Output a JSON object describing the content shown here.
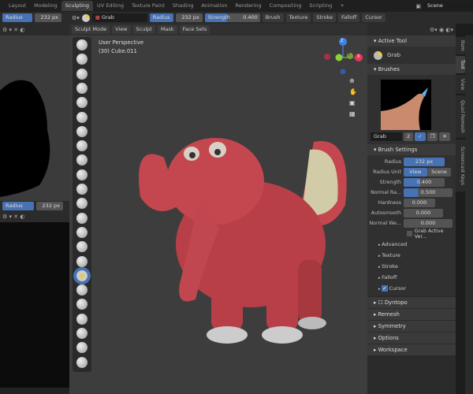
{
  "workspaces": [
    "Layout",
    "Modeling",
    "Sculpting",
    "UV Editing",
    "Texture Paint",
    "Shading",
    "Animation",
    "Rendering",
    "Compositing",
    "Scripting",
    "+"
  ],
  "active_workspace": "Sculpting",
  "scene": "Scene",
  "left_header": {
    "radius_label": "Radius",
    "radius_value": "232 px"
  },
  "tool_header": {
    "brush_name": "Grab",
    "radius_label": "Radius",
    "radius_value": "232 px",
    "strength_label": "Strength",
    "strength_value": "0.400",
    "strength_fraction": 0.4,
    "menus": [
      "Brush",
      "Texture",
      "Stroke",
      "Falloff",
      "Cursor"
    ]
  },
  "viewport_header": {
    "mode": "Sculpt Mode",
    "menus": [
      "View",
      "Sculpt",
      "Mask",
      "Face Sets"
    ]
  },
  "viewport": {
    "perspective": "User Perspective",
    "object": "(30) Cube.011",
    "gizmo": {
      "z": "Z",
      "y": "Y",
      "x": "X"
    }
  },
  "npanel": {
    "tabs": [
      "Item",
      "Tool",
      "View",
      "Quad Remesh",
      "Screencast Keys"
    ],
    "active_tab": "Tool",
    "active_tool": {
      "title": "Active Tool",
      "name": "Grab"
    },
    "brushes": {
      "title": "Brushes",
      "name": "Grab",
      "users": "2"
    },
    "brush_settings": {
      "title": "Brush Settings",
      "radius_label": "Radius",
      "radius_value": "232 px",
      "radius_unit_label": "Radius Unit",
      "radius_unit_options": [
        "View",
        "Scene"
      ],
      "radius_unit_selected": "View",
      "strength_label": "Strength",
      "strength_value": "0.400",
      "normal_radius_label": "Normal Ra...",
      "normal_radius_value": "0.500",
      "hardness_label": "Hardness",
      "hardness_value": "0.000",
      "autosmooth_label": "Autosmooth",
      "autosmooth_value": "0.000",
      "normal_weight_label": "Normal We...",
      "normal_weight_value": "0.000",
      "grab_active_label": "Grab Active Ver...",
      "subpanels": [
        "Advanced",
        "Texture",
        "Stroke",
        "Falloff"
      ],
      "cursor_label": "Cursor"
    },
    "panels": [
      "Remesh",
      "Symmetry",
      "Options",
      "Workspace"
    ],
    "dyntopo_label": "Dyntopo"
  },
  "colors": {
    "accent": "#4772b3",
    "body": "#c4474f",
    "ears": "#d2cba8"
  }
}
